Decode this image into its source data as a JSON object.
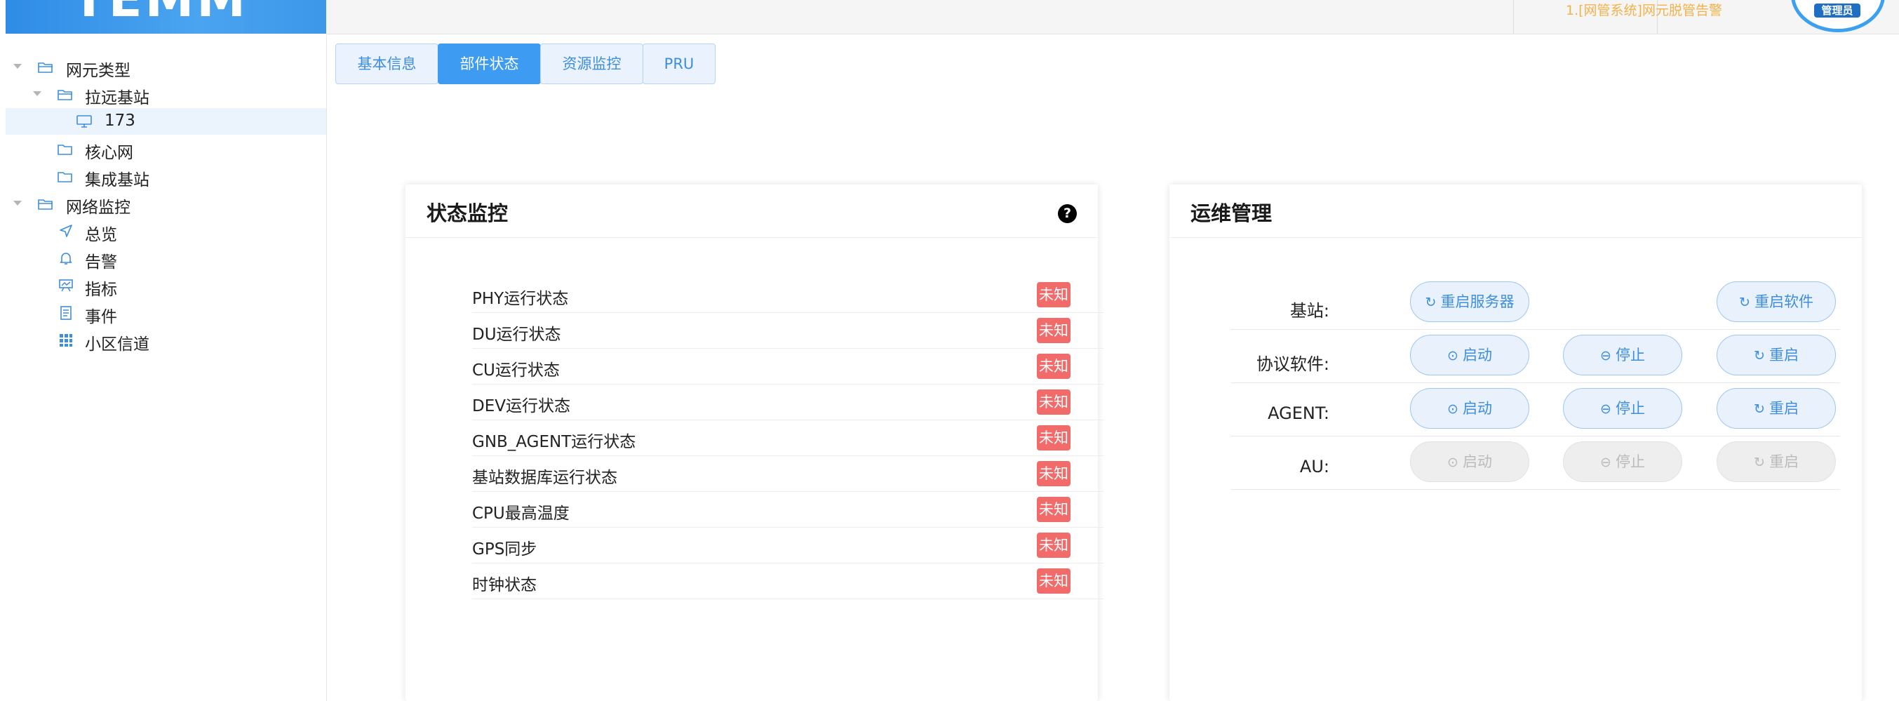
{
  "header": {
    "logo_text": "TEMM",
    "alarm_text": "1.[网管系统]网元脱管告警",
    "avatar_badge": "管理员"
  },
  "sidebar": {
    "tree": [
      {
        "label": "网元类型",
        "icon": "folder-open-icon",
        "expanded": true
      },
      {
        "label": "拉远基站",
        "icon": "folder-open-icon",
        "expanded": true
      },
      {
        "label": "173",
        "icon": "monitor-icon",
        "selected": true
      },
      {
        "label": "核心网",
        "icon": "folder-icon"
      },
      {
        "label": "集成基站",
        "icon": "folder-icon"
      },
      {
        "label": "网络监控",
        "icon": "folder-open-icon",
        "expanded": true
      },
      {
        "label": "总览",
        "icon": "navigation-arrow-icon"
      },
      {
        "label": "告警",
        "icon": "bell-icon"
      },
      {
        "label": "指标",
        "icon": "presentation-chart-icon"
      },
      {
        "label": "事件",
        "icon": "document-icon"
      },
      {
        "label": "小区信道",
        "icon": "grid-icon"
      }
    ]
  },
  "tabs": [
    {
      "label": "基本信息",
      "active": false
    },
    {
      "label": "部件状态",
      "active": true
    },
    {
      "label": "资源监控",
      "active": false
    },
    {
      "label": "PRU",
      "active": false
    }
  ],
  "status_panel": {
    "title": "状态监控",
    "help_icon": "question-circle-icon",
    "rows": [
      {
        "name": "PHY运行状态",
        "status": "未知"
      },
      {
        "name": "DU运行状态",
        "status": "未知"
      },
      {
        "name": "CU运行状态",
        "status": "未知"
      },
      {
        "name": "DEV运行状态",
        "status": "未知"
      },
      {
        "name": "GNB_AGENT运行状态",
        "status": "未知"
      },
      {
        "name": "基站数据库运行状态",
        "status": "未知"
      },
      {
        "name": "CPU最高温度",
        "status": "未知"
      },
      {
        "name": "GPS同步",
        "status": "未知"
      },
      {
        "name": "时钟状态",
        "status": "未知"
      }
    ],
    "badge_color": "#f26b6b"
  },
  "ops_panel": {
    "title": "运维管理",
    "rows": [
      {
        "name": "基站:",
        "buttons": [
          {
            "label": "重启服务器",
            "icon": "refresh-icon",
            "disabled": false
          },
          null,
          {
            "label": "重启软件",
            "icon": "refresh-icon",
            "disabled": false
          }
        ]
      },
      {
        "name": "协议软件:",
        "buttons": [
          {
            "label": "启动",
            "icon": "check-circle-icon",
            "disabled": false
          },
          {
            "label": "停止",
            "icon": "minus-circle-icon",
            "disabled": false
          },
          {
            "label": "重启",
            "icon": "refresh-icon",
            "disabled": false
          }
        ]
      },
      {
        "name": "AGENT:",
        "buttons": [
          {
            "label": "启动",
            "icon": "check-circle-icon",
            "disabled": false
          },
          {
            "label": "停止",
            "icon": "minus-circle-icon",
            "disabled": false
          },
          {
            "label": "重启",
            "icon": "refresh-icon",
            "disabled": false
          }
        ]
      },
      {
        "name": "AU:",
        "buttons": [
          {
            "label": "启动",
            "icon": "check-circle-icon",
            "disabled": true
          },
          {
            "label": "停止",
            "icon": "minus-circle-icon",
            "disabled": true
          },
          {
            "label": "重启",
            "icon": "refresh-icon",
            "disabled": true
          }
        ]
      }
    ]
  },
  "colors": {
    "accent": "#3d9cf2",
    "alarm": "#f2b24a",
    "unknown_badge": "#f26b6b"
  }
}
